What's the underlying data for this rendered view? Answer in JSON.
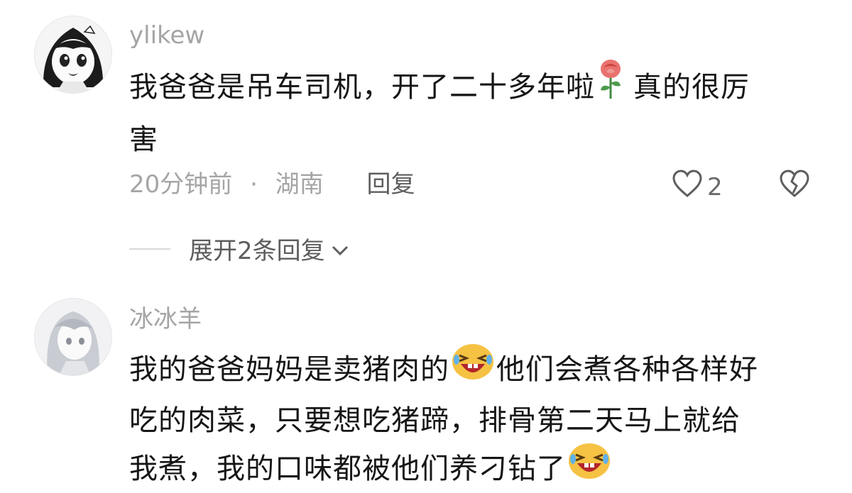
{
  "comments": [
    {
      "username": "ylikew",
      "lines": [
        "我爸爸是吊车司机，开了二十多年啦",
        "真的很厉",
        "害"
      ],
      "time": "20分钟前",
      "separator": "·",
      "location": "湖南",
      "reply_label": "回复",
      "like_count": "2",
      "inline_emoji": "rose-icon"
    },
    {
      "username": "冰冰羊",
      "lines": [
        "我的爸爸妈妈是卖猪肉的",
        "他们会煮各种各样好",
        "吃的肉菜，只要想吃猪蹄，排骨第二天马上就给",
        "我煮，我的口味都被他们养刁钻了"
      ],
      "inline_emoji": "laughing-face-icon"
    }
  ],
  "expand_replies": {
    "label": "展开2条回复"
  },
  "colors": {
    "username": "#a5a5a5",
    "text": "#161616",
    "muted": "#5e5e5e"
  }
}
